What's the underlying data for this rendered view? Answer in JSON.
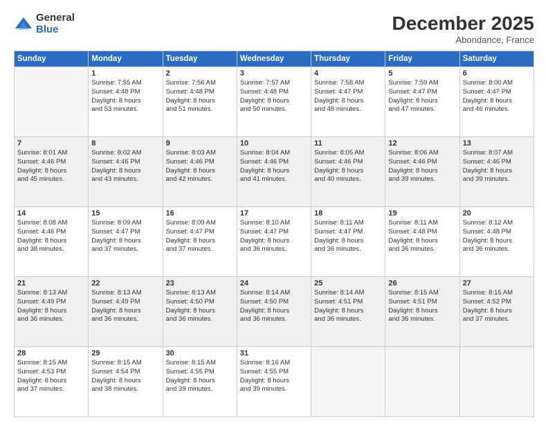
{
  "logo": {
    "general": "General",
    "blue": "Blue"
  },
  "header": {
    "month": "December 2025",
    "location": "Abondance, France"
  },
  "days_of_week": [
    "Sunday",
    "Monday",
    "Tuesday",
    "Wednesday",
    "Thursday",
    "Friday",
    "Saturday"
  ],
  "weeks": [
    [
      {
        "day": "",
        "empty": true
      },
      {
        "day": "1",
        "sunrise": "Sunrise: 7:55 AM",
        "sunset": "Sunset: 4:48 PM",
        "daylight": "Daylight: 8 hours and 53 minutes."
      },
      {
        "day": "2",
        "sunrise": "Sunrise: 7:56 AM",
        "sunset": "Sunset: 4:48 PM",
        "daylight": "Daylight: 8 hours and 51 minutes."
      },
      {
        "day": "3",
        "sunrise": "Sunrise: 7:57 AM",
        "sunset": "Sunset: 4:48 PM",
        "daylight": "Daylight: 8 hours and 50 minutes."
      },
      {
        "day": "4",
        "sunrise": "Sunrise: 7:58 AM",
        "sunset": "Sunset: 4:47 PM",
        "daylight": "Daylight: 8 hours and 48 minutes."
      },
      {
        "day": "5",
        "sunrise": "Sunrise: 7:59 AM",
        "sunset": "Sunset: 4:47 PM",
        "daylight": "Daylight: 8 hours and 47 minutes."
      },
      {
        "day": "6",
        "sunrise": "Sunrise: 8:00 AM",
        "sunset": "Sunset: 4:47 PM",
        "daylight": "Daylight: 8 hours and 46 minutes."
      }
    ],
    [
      {
        "day": "7",
        "sunrise": "Sunrise: 8:01 AM",
        "sunset": "Sunset: 4:46 PM",
        "daylight": "Daylight: 8 hours and 45 minutes."
      },
      {
        "day": "8",
        "sunrise": "Sunrise: 8:02 AM",
        "sunset": "Sunset: 4:46 PM",
        "daylight": "Daylight: 8 hours and 43 minutes."
      },
      {
        "day": "9",
        "sunrise": "Sunrise: 8:03 AM",
        "sunset": "Sunset: 4:46 PM",
        "daylight": "Daylight: 8 hours and 42 minutes."
      },
      {
        "day": "10",
        "sunrise": "Sunrise: 8:04 AM",
        "sunset": "Sunset: 4:46 PM",
        "daylight": "Daylight: 8 hours and 41 minutes."
      },
      {
        "day": "11",
        "sunrise": "Sunrise: 8:05 AM",
        "sunset": "Sunset: 4:46 PM",
        "daylight": "Daylight: 8 hours and 40 minutes."
      },
      {
        "day": "12",
        "sunrise": "Sunrise: 8:06 AM",
        "sunset": "Sunset: 4:46 PM",
        "daylight": "Daylight: 8 hours and 39 minutes."
      },
      {
        "day": "13",
        "sunrise": "Sunrise: 8:07 AM",
        "sunset": "Sunset: 4:46 PM",
        "daylight": "Daylight: 8 hours and 39 minutes."
      }
    ],
    [
      {
        "day": "14",
        "sunrise": "Sunrise: 8:08 AM",
        "sunset": "Sunset: 4:46 PM",
        "daylight": "Daylight: 8 hours and 38 minutes."
      },
      {
        "day": "15",
        "sunrise": "Sunrise: 8:09 AM",
        "sunset": "Sunset: 4:47 PM",
        "daylight": "Daylight: 8 hours and 37 minutes."
      },
      {
        "day": "16",
        "sunrise": "Sunrise: 8:09 AM",
        "sunset": "Sunset: 4:47 PM",
        "daylight": "Daylight: 8 hours and 37 minutes."
      },
      {
        "day": "17",
        "sunrise": "Sunrise: 8:10 AM",
        "sunset": "Sunset: 4:47 PM",
        "daylight": "Daylight: 8 hours and 36 minutes."
      },
      {
        "day": "18",
        "sunrise": "Sunrise: 8:11 AM",
        "sunset": "Sunset: 4:47 PM",
        "daylight": "Daylight: 8 hours and 36 minutes."
      },
      {
        "day": "19",
        "sunrise": "Sunrise: 8:11 AM",
        "sunset": "Sunset: 4:48 PM",
        "daylight": "Daylight: 8 hours and 36 minutes."
      },
      {
        "day": "20",
        "sunrise": "Sunrise: 8:12 AM",
        "sunset": "Sunset: 4:48 PM",
        "daylight": "Daylight: 8 hours and 36 minutes."
      }
    ],
    [
      {
        "day": "21",
        "sunrise": "Sunrise: 8:13 AM",
        "sunset": "Sunset: 4:49 PM",
        "daylight": "Daylight: 8 hours and 36 minutes."
      },
      {
        "day": "22",
        "sunrise": "Sunrise: 8:13 AM",
        "sunset": "Sunset: 4:49 PM",
        "daylight": "Daylight: 8 hours and 36 minutes."
      },
      {
        "day": "23",
        "sunrise": "Sunrise: 8:13 AM",
        "sunset": "Sunset: 4:50 PM",
        "daylight": "Daylight: 8 hours and 36 minutes."
      },
      {
        "day": "24",
        "sunrise": "Sunrise: 8:14 AM",
        "sunset": "Sunset: 4:50 PM",
        "daylight": "Daylight: 8 hours and 36 minutes."
      },
      {
        "day": "25",
        "sunrise": "Sunrise: 8:14 AM",
        "sunset": "Sunset: 4:51 PM",
        "daylight": "Daylight: 8 hours and 36 minutes."
      },
      {
        "day": "26",
        "sunrise": "Sunrise: 8:15 AM",
        "sunset": "Sunset: 4:51 PM",
        "daylight": "Daylight: 8 hours and 36 minutes."
      },
      {
        "day": "27",
        "sunrise": "Sunrise: 8:15 AM",
        "sunset": "Sunset: 4:52 PM",
        "daylight": "Daylight: 8 hours and 37 minutes."
      }
    ],
    [
      {
        "day": "28",
        "sunrise": "Sunrise: 8:15 AM",
        "sunset": "Sunset: 4:53 PM",
        "daylight": "Daylight: 8 hours and 37 minutes."
      },
      {
        "day": "29",
        "sunrise": "Sunrise: 8:15 AM",
        "sunset": "Sunset: 4:54 PM",
        "daylight": "Daylight: 8 hours and 38 minutes."
      },
      {
        "day": "30",
        "sunrise": "Sunrise: 8:15 AM",
        "sunset": "Sunset: 4:55 PM",
        "daylight": "Daylight: 8 hours and 39 minutes."
      },
      {
        "day": "31",
        "sunrise": "Sunrise: 8:16 AM",
        "sunset": "Sunset: 4:55 PM",
        "daylight": "Daylight: 8 hours and 39 minutes."
      },
      {
        "day": "",
        "empty": true
      },
      {
        "day": "",
        "empty": true
      },
      {
        "day": "",
        "empty": true
      }
    ]
  ]
}
